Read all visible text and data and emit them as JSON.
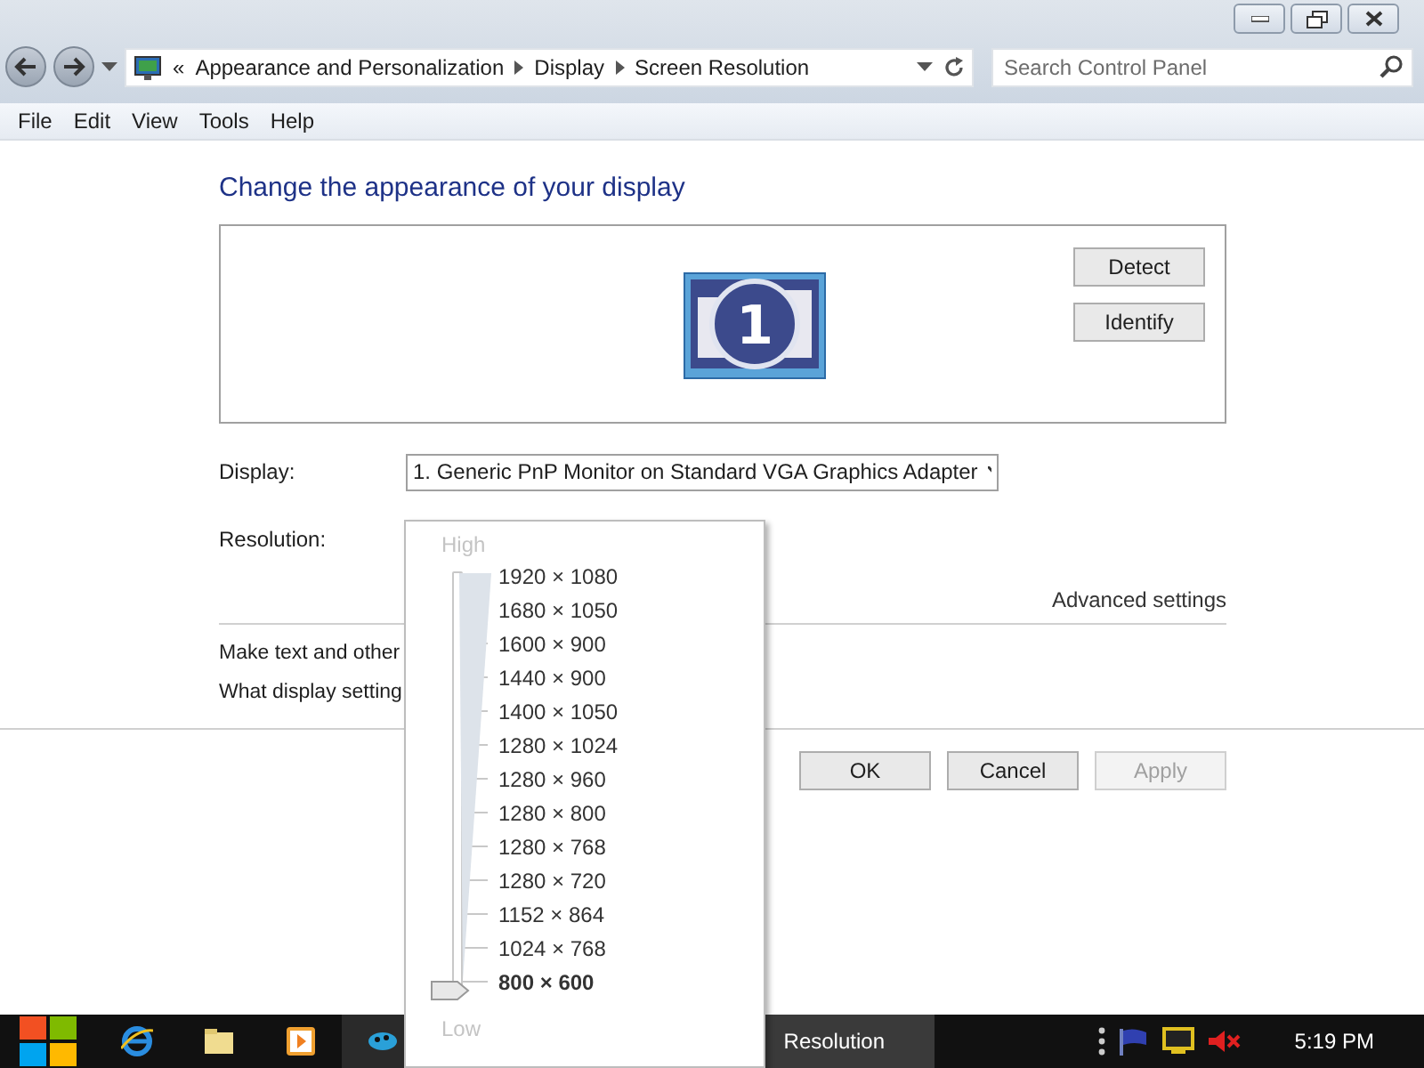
{
  "address_bar": {
    "crumbs": [
      "Appearance and Personalization",
      "Display",
      "Screen Resolution"
    ],
    "overflow": "«"
  },
  "search": {
    "placeholder": "Search Control Panel"
  },
  "menu": [
    "File",
    "Edit",
    "View",
    "Tools",
    "Help"
  ],
  "heading": "Change the appearance of your display",
  "monitor": {
    "number": "1"
  },
  "buttons_side": [
    "Detect",
    "Identify"
  ],
  "display": {
    "label": "Display:",
    "value": "1. Generic PnP Monitor on Standard VGA Graphics Adapter"
  },
  "resolution": {
    "label": "Resolution:"
  },
  "advanced_link": "Advanced settings",
  "links": [
    "Make text and other",
    "What display setting"
  ],
  "buttons": [
    {
      "label": "OK",
      "disabled": false
    },
    {
      "label": "Cancel",
      "disabled": false
    },
    {
      "label": "Apply",
      "disabled": true
    }
  ],
  "resolution_popup": {
    "high": "High",
    "low": "Low",
    "level": 0,
    "options": [
      {
        "label": "1920 × 1080",
        "selected": false
      },
      {
        "label": "1680 × 1050",
        "selected": false
      },
      {
        "label": "1600 × 900",
        "selected": false
      },
      {
        "label": "1440 × 900",
        "selected": false
      },
      {
        "label": "1400 × 1050",
        "selected": false
      },
      {
        "label": "1280 × 1024",
        "selected": false
      },
      {
        "label": "1280 × 960",
        "selected": false
      },
      {
        "label": "1280 × 800",
        "selected": false
      },
      {
        "label": "1280 × 768",
        "selected": false
      },
      {
        "label": "1280 × 720",
        "selected": false
      },
      {
        "label": "1152 × 864",
        "selected": false
      },
      {
        "label": "1024 × 768",
        "selected": false
      },
      {
        "label": "800 × 600",
        "selected": true
      }
    ]
  },
  "taskbar": {
    "window_label": "Resolution",
    "clock": "5:19 PM"
  }
}
